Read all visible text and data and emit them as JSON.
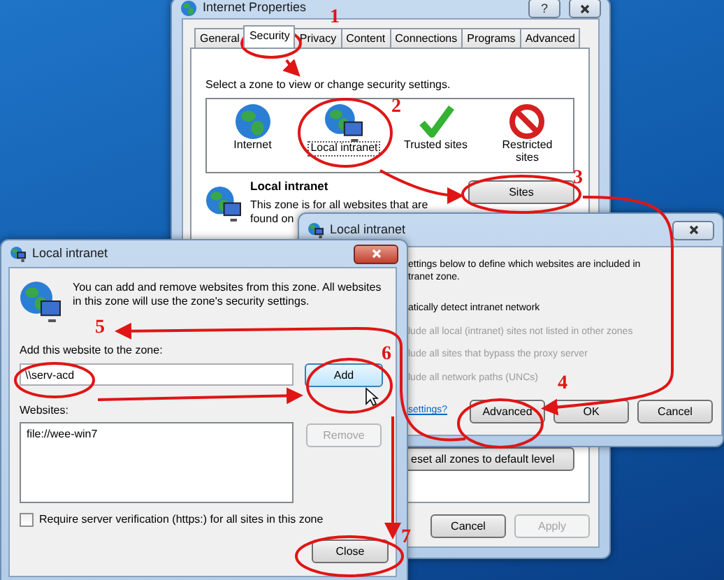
{
  "internet_properties": {
    "title": "Internet Properties",
    "help_button": "?",
    "tabs": [
      {
        "label": "General",
        "selected": false
      },
      {
        "label": "Security",
        "selected": true
      },
      {
        "label": "Privacy",
        "selected": false
      },
      {
        "label": "Content",
        "selected": false
      },
      {
        "label": "Connections",
        "selected": false
      },
      {
        "label": "Programs",
        "selected": false
      },
      {
        "label": "Advanced",
        "selected": false
      }
    ],
    "zone_prompt": "Select a zone to view or change security settings.",
    "zones": [
      {
        "label": "Internet",
        "kind": "globe",
        "selected": false
      },
      {
        "label": "Local intranet",
        "kind": "intranet",
        "selected": true
      },
      {
        "label": "Trusted sites",
        "kind": "trusted",
        "selected": false
      },
      {
        "label": "Restricted sites",
        "kind": "restricted",
        "selected": false
      }
    ],
    "zone_title": "Local intranet",
    "zone_description": [
      "This zone is for all websites that are",
      "found on"
    ],
    "sites_button": "Sites",
    "reset_button": "eset all zones to default level",
    "buttons": [
      {
        "label": "Cancel",
        "disabled": false
      },
      {
        "label": "Apply",
        "disabled": true
      }
    ]
  },
  "local_intranet_settings": {
    "title": "Local intranet",
    "intro": [
      "ettings below to define which websites are included in",
      "tranet zone."
    ],
    "options": [
      {
        "label": "atically detect intranet network",
        "disabled": false
      },
      {
        "label": "lude all local (intranet) sites not listed in other zones",
        "disabled": true
      },
      {
        "label": "lude all sites that bypass the proxy server",
        "disabled": true
      },
      {
        "label": "lude all network paths (UNCs)",
        "disabled": true
      }
    ],
    "link": "settings?",
    "buttons": [
      "Advanced",
      "OK",
      "Cancel"
    ]
  },
  "local_intranet_sites": {
    "title": "Local intranet",
    "description": "You can add and remove websites from this zone. All websites in this zone will use the zone's security settings.",
    "add_label": "Add this website to the zone:",
    "add_value": "\\\\serv-acd",
    "add_button": "Add",
    "websites_label": "Websites:",
    "websites": [
      "file://wee-win7"
    ],
    "remove_button": {
      "label": "Remove",
      "disabled": true
    },
    "require_https": {
      "label": "Require server verification (https:) for all sites in this zone",
      "checked": false
    },
    "close_button": "Close"
  },
  "annotations": [
    {
      "label": "1"
    },
    {
      "label": "2"
    },
    {
      "label": "3"
    },
    {
      "label": "4"
    },
    {
      "label": "5"
    },
    {
      "label": "6"
    },
    {
      "label": "7"
    }
  ]
}
